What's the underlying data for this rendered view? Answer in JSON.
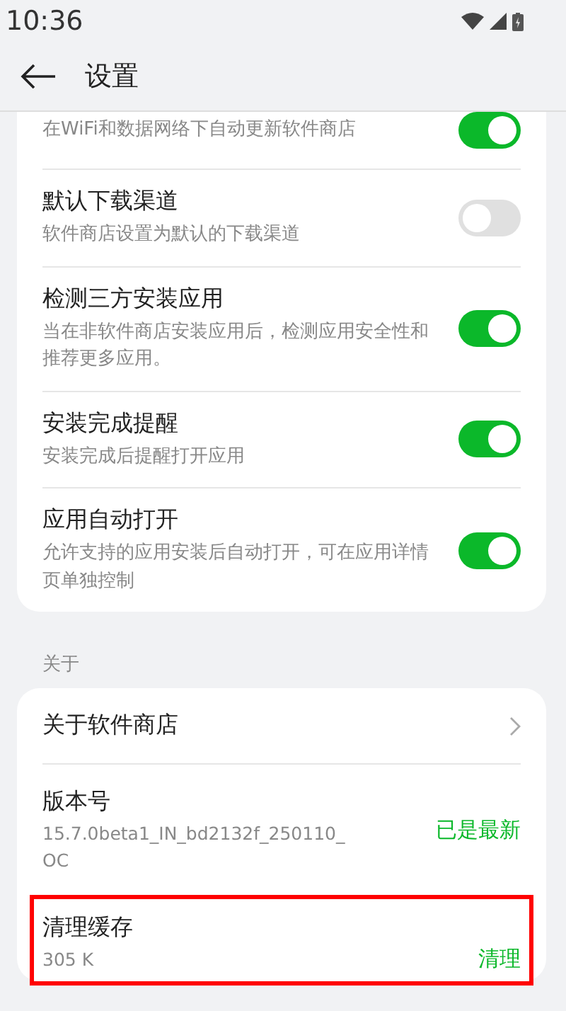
{
  "status_bar": {
    "time": "10:36"
  },
  "header": {
    "title": "设置"
  },
  "settings": [
    {
      "subtitle": "在WiFi和数据网络下自动更新软件商店",
      "on": true
    },
    {
      "title": "默认下载渠道",
      "subtitle": "软件商店设置为默认的下载渠道",
      "on": false
    },
    {
      "title": "检测三方安装应用",
      "subtitle": "当在非软件商店安装应用后，检测应用安全性和推荐更多应用。",
      "on": true
    },
    {
      "title": "安装完成提醒",
      "subtitle": "安装完成后提醒打开应用",
      "on": true
    },
    {
      "title": "应用自动打开",
      "subtitle": "允许支持的应用安装后自动打开，可在应用详情页单独控制",
      "on": true
    }
  ],
  "about": {
    "section_title": "关于",
    "items": [
      {
        "kind": "link",
        "title": "关于软件商店",
        "highlighted": false
      },
      {
        "kind": "action",
        "title": "版本号",
        "subtitle": "15.7.0beta1_IN_bd2132f_250110_OC",
        "action": "已是最新",
        "highlighted": false
      },
      {
        "kind": "action",
        "title": "清理缓存",
        "subtitle": "305 K",
        "action": "清理",
        "highlighted": true
      }
    ]
  }
}
